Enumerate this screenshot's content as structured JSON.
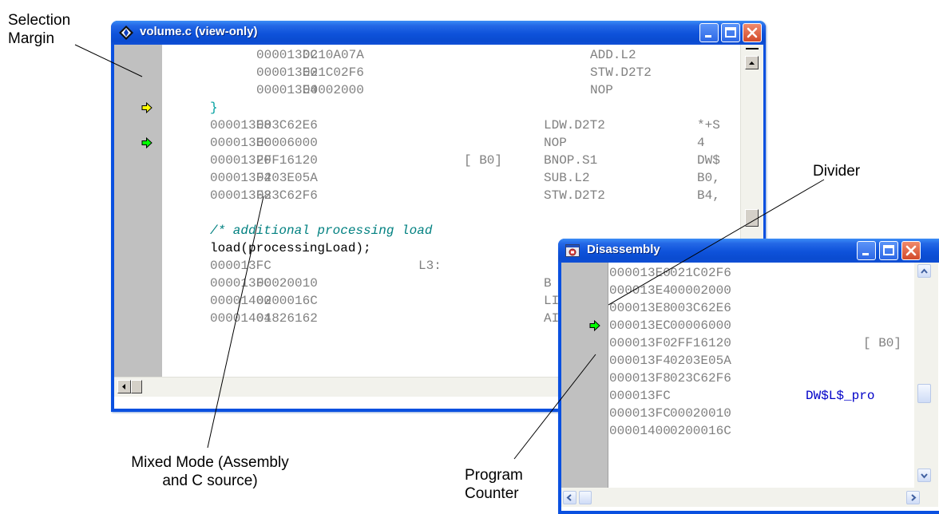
{
  "annotations": {
    "selection_margin": [
      "Selection",
      "Margin"
    ],
    "divider": "Divider",
    "mixed_mode": [
      "Mixed Mode (Assembly",
      "and C source)"
    ],
    "program_counter": [
      "Program",
      "Counter"
    ]
  },
  "source_window": {
    "title": "volume.c (view-only)",
    "icon": "diamond-arrows-icon",
    "rows": [
      {
        "addr": "000013DC",
        "op": "0210A07A",
        "pred": "",
        "mnem": "ADD.L2",
        "args": ""
      },
      {
        "addr": "000013E0",
        "op": "021C02F6",
        "pred": "",
        "mnem": "STW.D2T2",
        "args": ""
      },
      {
        "addr": "000013E4",
        "op": "00002000",
        "pred": "",
        "mnem": "NOP",
        "args": ""
      },
      {
        "brace": "}"
      },
      {
        "addr": "000013E8",
        "op": "003C62E6",
        "pred": "",
        "mnem": "LDW.D2T2",
        "args": "*+S"
      },
      {
        "addr": "000013EC",
        "op": "00006000",
        "pred": "",
        "mnem": "NOP",
        "args": "4"
      },
      {
        "addr": "000013F0",
        "op": "2FF16120",
        "pred": "[ B0]",
        "mnem": "BNOP.S1",
        "args": "DW$"
      },
      {
        "addr": "000013F4",
        "op": "0203E05A",
        "pred": "",
        "mnem": "SUB.L2",
        "args": "B0,"
      },
      {
        "addr": "000013F8",
        "op": "023C62F6",
        "pred": "",
        "mnem": "STW.D2T2",
        "args": "B4,"
      },
      {
        "blank": true
      },
      {
        "comment": "/* additional processing load"
      },
      {
        "source": "load(processingLoad);"
      },
      {
        "addr": "000013FC",
        "label": "L3:"
      },
      {
        "addr": "000013FC",
        "op": "00020010",
        "pred": "",
        "mnem": "B",
        "args": ""
      },
      {
        "addr": "00001400",
        "op": "0200016C",
        "pred": "",
        "mnem": "LI",
        "args": ""
      },
      {
        "addr": "00001404",
        "op": "01826162",
        "pred": "",
        "mnem": "AI",
        "args": ""
      }
    ],
    "markers": [
      {
        "row": 3,
        "color": "#ffff00"
      },
      {
        "row": 5,
        "color": "#00ff00"
      }
    ]
  },
  "disasm_window": {
    "title": "Disassembly",
    "icon": "disassembly-window-icon",
    "rows": [
      {
        "addr": "000013E0",
        "op": "021C02F6",
        "extra": ""
      },
      {
        "addr": "000013E4",
        "op": "00002000",
        "extra": ""
      },
      {
        "addr": "000013E8",
        "op": "003C62E6",
        "extra": ""
      },
      {
        "addr": "000013EC",
        "op": "00006000",
        "extra": ""
      },
      {
        "addr": "000013F0",
        "op": "2FF16120",
        "extra": "[ B0]"
      },
      {
        "addr": "000013F4",
        "op": "0203E05A",
        "extra": ""
      },
      {
        "addr": "000013F8",
        "op": "023C62F6",
        "extra": ""
      },
      {
        "addr": "000013FC",
        "op": "",
        "extra": "DW$L$_pro"
      },
      {
        "addr": "000013FC",
        "op": "00020010",
        "extra": ""
      },
      {
        "addr": "00001400",
        "op": "0200016C",
        "extra": ""
      }
    ],
    "pc_row": 3,
    "pc_color": "#00ff00"
  }
}
